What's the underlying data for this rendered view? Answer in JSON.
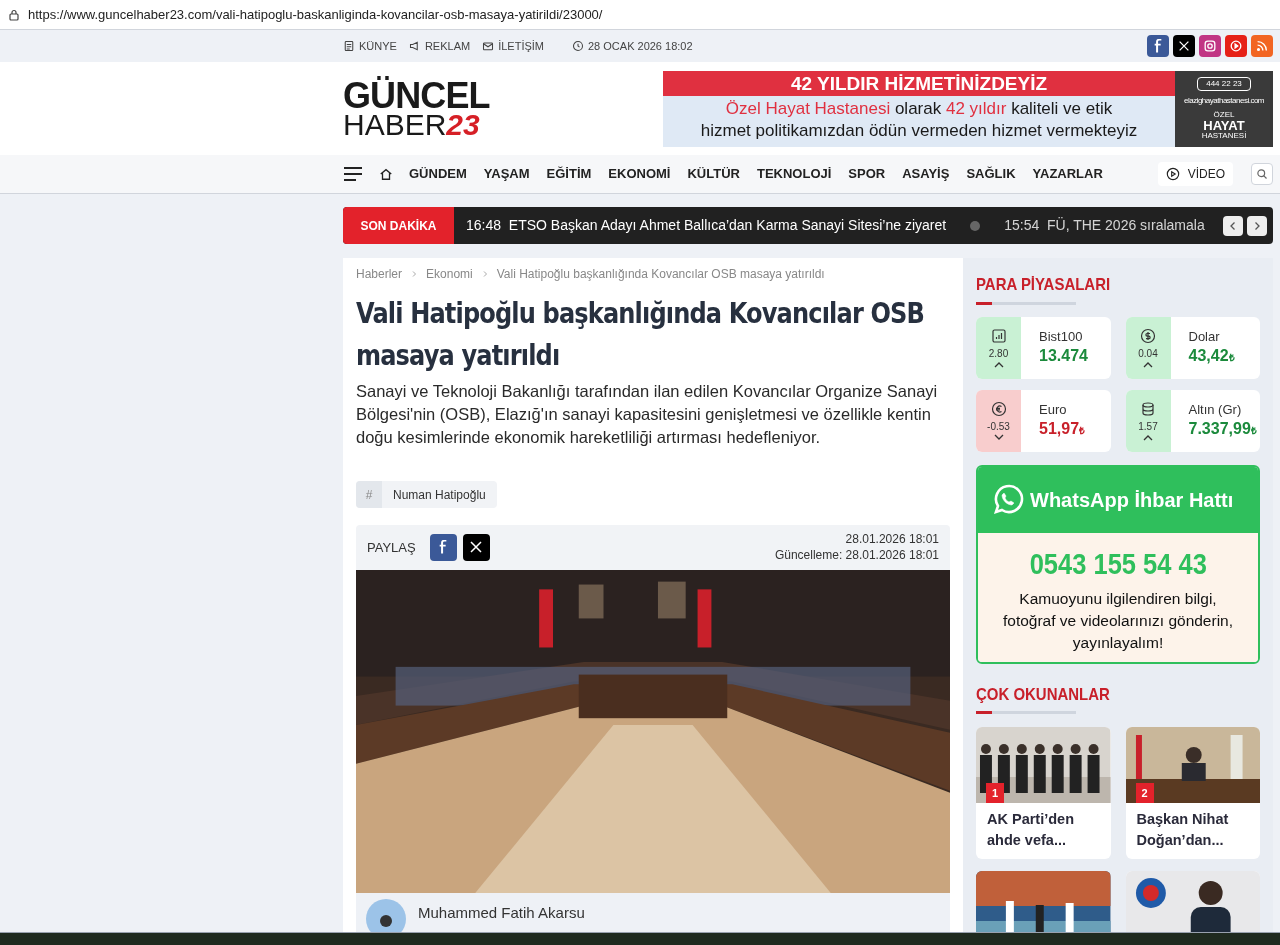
{
  "url": "https://www.guncelhaber23.com/vali-hatipoglu-baskanliginda-kovancilar-osb-masaya-yatirildi/23000/",
  "topbar": {
    "links": [
      {
        "kind": "id",
        "label": "KÜNYE"
      },
      {
        "kind": "ad",
        "label": "REKLAM"
      },
      {
        "kind": "mail",
        "label": "İLETİŞİM"
      }
    ],
    "date": "28 OCAK 2026 18:02",
    "social": [
      {
        "kind": "facebook",
        "color": "#3b5998"
      },
      {
        "kind": "x",
        "color": "#000000"
      },
      {
        "kind": "instagram",
        "color": "#c13584"
      },
      {
        "kind": "youtube",
        "color": "#e62117"
      },
      {
        "kind": "rss",
        "color": "#f26522"
      }
    ]
  },
  "logo": {
    "top": "GÜNCEL",
    "bottom": "HABER",
    "number": "23"
  },
  "ad": {
    "headline": "42 YILDIR HİZMETİNİZDEYİZ",
    "line1": [
      {
        "text": "Özel Hayat Hastanesi",
        "highlight": true
      },
      {
        "text": " olarak ",
        "highlight": false
      },
      {
        "text": "42 yıldır",
        "highlight": true
      },
      {
        "text": " kaliteli ve etik",
        "highlight": false
      }
    ],
    "line2": "hizmet politikamızdan ödün vermeden hizmet vermekteyiz",
    "phone": "444 22 23",
    "site": "elazighayathastanesi.com",
    "brand_top": "ÖZEL",
    "brand": "HAYAT",
    "brand_bottom": "HASTANESİ"
  },
  "nav": {
    "items": [
      {
        "label": "GÜNDEM"
      },
      {
        "label": "YAŞAM"
      },
      {
        "label": "EĞİTİM"
      },
      {
        "label": "EKONOMİ"
      },
      {
        "label": "KÜLTÜR"
      },
      {
        "label": "TEKNOLOJİ"
      },
      {
        "label": "SPOR"
      },
      {
        "label": "ASAYİŞ"
      },
      {
        "label": "SAĞLIK"
      },
      {
        "label": "YAZARLAR"
      }
    ],
    "video": "VİDEO"
  },
  "ticker": {
    "label": "SON DAKİKA",
    "items": [
      {
        "time": "16:48",
        "text": "ETSO Başkan Adayı Ahmet Ballıca’dan Karma Sanayi Sitesi’ne ziyaret"
      },
      {
        "time": "15:54",
        "text": "FÜ, THE 2026 sıralamala"
      }
    ]
  },
  "article": {
    "breadcrumbs": [
      {
        "label": "Haberler"
      },
      {
        "label": "Ekonomi"
      },
      {
        "label": "Vali Hatipoğlu başkanlığında Kovancılar OSB masaya yatırıldı"
      }
    ],
    "title": "Vali Hatipoğlu başkanlığında Kovancılar OSB masaya yatırıldı",
    "summary": "Sanayi ve Teknoloji Bakanlığı tarafından ilan edilen Kovancılar Organize Sanayi Bölgesi'nin (OSB), Elazığ'ın sanayi kapasitesini genişletmesi ve özellikle kentin doğu kesimlerinde ekonomik hareketliliği artırması hedefleniyor.",
    "tag_mark": "#",
    "tags": [
      {
        "label": "Numan Hatipoğlu"
      }
    ],
    "share_label": "PAYLAŞ",
    "share": [
      {
        "kind": "facebook",
        "color": "#3b5998"
      },
      {
        "kind": "x",
        "color": "#000000"
      }
    ],
    "published": "28.01.2026 18:01",
    "updated": "Güncelleme: 28.01.2026 18:01",
    "photo": {
      "kind": "picture"
    },
    "author": "Muhammed Fatih Akarsu"
  },
  "markets": {
    "title": "PARA PİYASALARI",
    "items": [
      {
        "kind": "chart",
        "name": "Bist100",
        "change": "2.80",
        "value": "13.474",
        "up": true
      },
      {
        "kind": "dollar",
        "name": "Dolar",
        "change": "0.04",
        "value": "43,42",
        "currency": "₺",
        "up": true
      },
      {
        "kind": "euro",
        "name": "Euro",
        "change": "-0.53",
        "value": "51,97",
        "currency": "₺",
        "up": false
      },
      {
        "kind": "coins",
        "name": "Altın (Gr)",
        "change": "1.57",
        "value": "7.337,99",
        "currency": "₺",
        "up": true
      }
    ]
  },
  "whatsapp": {
    "title": "WhatsApp İhbar Hattı",
    "phone": "0543 155 54 43",
    "text": "Kamuoyunu ilgilendiren bilgi, fotoğraf ve videolarınızı gönderin, yayınlayalım!"
  },
  "most_read": {
    "title": "ÇOK OKUNANLAR",
    "items": [
      {
        "rank": "1",
        "title": "AK Parti’den ahde vefa..."
      },
      {
        "rank": "2",
        "title": "Başkan Nihat Doğan’dan..."
      },
      {
        "kind": "picture"
      },
      {
        "kind": "picture"
      }
    ]
  }
}
